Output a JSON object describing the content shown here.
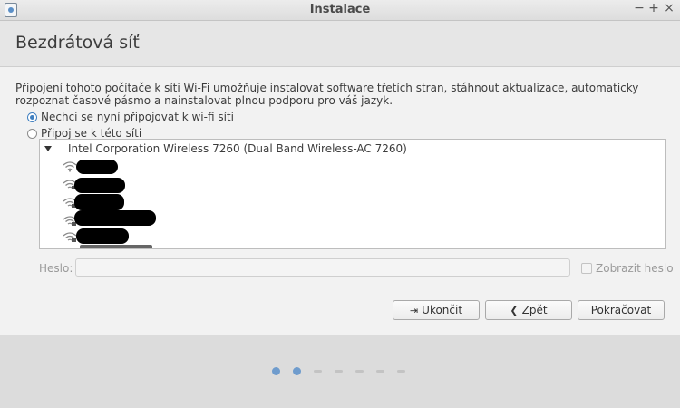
{
  "window": {
    "title": "Instalace",
    "controls": {
      "minimize": "−",
      "maximize": "+",
      "close": "×"
    }
  },
  "page": {
    "title": "Bezdrátová síť",
    "description": "Připojení tohoto počítače k síti Wi-Fi umožňuje instalovat software třetích stran, stáhnout aktualizace, automaticky rozpoznat časové pásmo a nainstalovat plnou podporu pro váš jazyk."
  },
  "options": {
    "no_connect": {
      "label": "Nechci se nyní připojovat k wi-fi síti",
      "selected": true
    },
    "connect": {
      "label": "Připoj se k této síti",
      "selected": false
    }
  },
  "network_list": {
    "device": "Intel Corporation Wireless 7260 (Dual Band Wireless-AC 7260)",
    "networks": [
      "",
      "",
      "",
      "",
      "",
      ""
    ]
  },
  "password": {
    "label": "Heslo:",
    "value": "",
    "show_label": "Zobrazit heslo",
    "show_checked": false
  },
  "buttons": {
    "quit": "Ukončit",
    "back": "Zpět",
    "continue": "Pokračovat"
  },
  "progress": {
    "total_steps": 7,
    "completed_steps": 2
  },
  "colors": {
    "accent": "#3f7fc0",
    "progress_dot": "#6f9ccd"
  }
}
